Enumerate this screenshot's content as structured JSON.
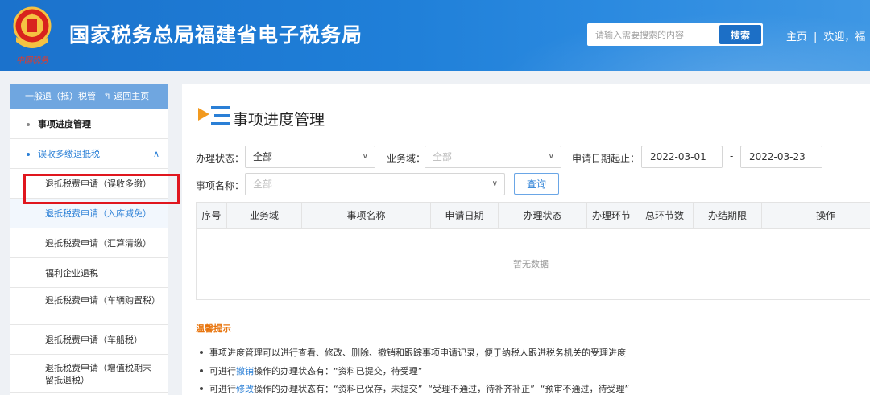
{
  "header": {
    "title": "国家税务总局福建省电子税务局",
    "emblem_caption": "中国税务",
    "search_placeholder": "请输入需要搜索的内容",
    "search_button": "搜索",
    "nav_home": "主页",
    "nav_separator": "|",
    "nav_welcome": "欢迎，福"
  },
  "sidebar": {
    "head_label": "一般退（抵）税管",
    "back_label": "返回主页",
    "items": [
      {
        "label": "事项进度管理"
      },
      {
        "label": "误收多缴退抵税"
      },
      {
        "label": "退抵税费申请（误收多缴）"
      },
      {
        "label": "退抵税费申请（入库减免）"
      },
      {
        "label": "退抵税费申请（汇算清缴）"
      },
      {
        "label": "福利企业退税"
      },
      {
        "label": "退抵税费申请（车辆购置税）"
      },
      {
        "label": "退抵税费申请（车船税）"
      },
      {
        "label": "退抵税费申请（增值税期末留抵退税）"
      }
    ]
  },
  "main": {
    "title": "事项进度管理",
    "filters": {
      "status_label": "办理状态：",
      "status_value": "全部",
      "domain_label": "业务域：",
      "domain_placeholder": "全部",
      "date_label": "申请日期起止：",
      "date_start": "2022-03-01",
      "date_sep": "-",
      "date_end": "2022-03-23",
      "name_label": "事项名称：",
      "name_placeholder": "全部",
      "query_button": "查询"
    },
    "table": {
      "columns": [
        "序号",
        "业务域",
        "事项名称",
        "申请日期",
        "办理状态",
        "办理环节",
        "总环节数",
        "办结期限",
        "操作"
      ],
      "empty_text": "暂无数据"
    },
    "tips": {
      "title": "温馨提示",
      "line1": "事项进度管理可以进行查看、修改、删除、撤销和跟踪事项申请记录，便于纳税人跟进税务机关的受理进度",
      "line2_pre": "可进行",
      "line2_link": "撤销",
      "line2_post": "操作的办理状态有：“资料已提交，待受理”",
      "line3_pre": "可进行",
      "line3_link": "修改",
      "line3_post": "操作的办理状态有：“资料已保存，未提交”  “受理不通过，待补齐补正”  “预审不通过，待受理”"
    }
  },
  "colors": {
    "header_blue": "#1f7fd8",
    "link_blue": "#2a7fd6",
    "tip_orange": "#e8740c",
    "highlight_red": "#e0161e"
  }
}
